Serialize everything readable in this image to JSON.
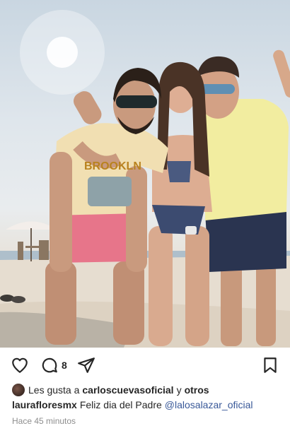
{
  "post": {
    "image_alt": "Three people posing on a sandy beach making peace signs",
    "comment_count": "8"
  },
  "actions": {
    "like_icon": "heart-icon",
    "comment_icon": "comment-icon",
    "share_icon": "send-icon",
    "save_icon": "bookmark-icon"
  },
  "likes": {
    "prefix": "Les gusta a",
    "user": "carloscuevasoficial",
    "joiner": "y",
    "others": "otros"
  },
  "caption": {
    "username": "lauraflores​mx",
    "text": "Feliz dia del Padre",
    "mention": "@lalosalazar_oficial"
  },
  "timestamp": "Hace 45 minutos",
  "colors": {
    "mention": "#385898",
    "text": "#262626",
    "muted": "#8e8e8e"
  }
}
